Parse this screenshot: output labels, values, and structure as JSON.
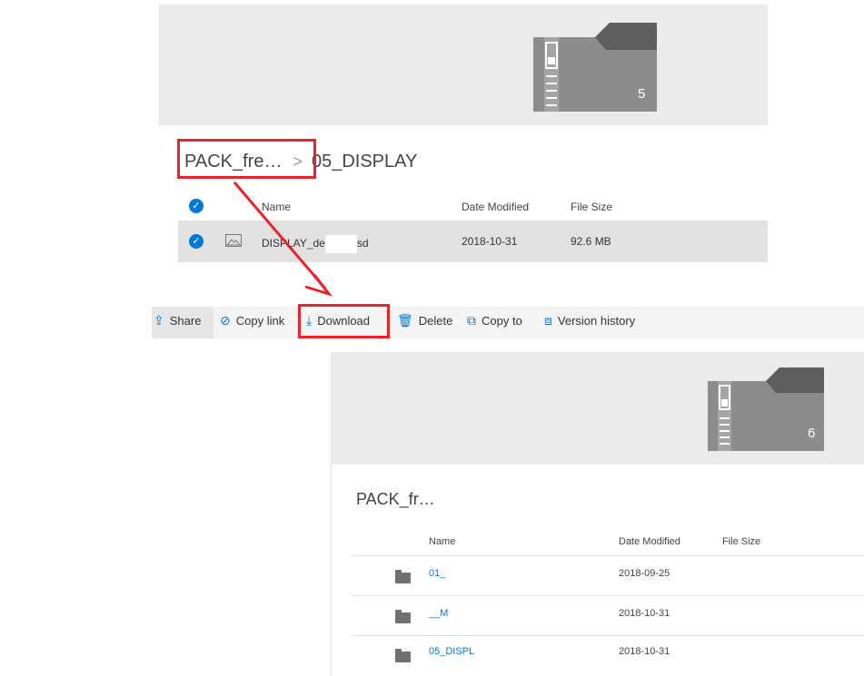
{
  "top_view": {
    "zip_count": "5",
    "breadcrumb": {
      "root": "PACK_fre…",
      "separator": ">",
      "current": "05_DISPLAY"
    },
    "columns": {
      "name": "Name",
      "date": "Date Modified",
      "size": "File Size"
    },
    "row": {
      "name": "DISPLAY_de",
      "name_suffix": "sd",
      "date": "2018-10-31",
      "size": "92.6 MB",
      "icon": "image-icon"
    }
  },
  "commands": {
    "share": "Share",
    "copy_link": "Copy link",
    "download": "Download",
    "delete": "Delete",
    "copy_to": "Copy to",
    "version_history": "Version history"
  },
  "bottom_view": {
    "zip_count": "6",
    "title": "PACK_fr…",
    "columns": {
      "name": "Name",
      "date": "Date Modified",
      "size": "File Size"
    },
    "rows": [
      {
        "name": "01_",
        "date": "2018-09-25"
      },
      {
        "name": "__M",
        "date": "2018-10-31"
      },
      {
        "name": "05_DISPL",
        "date": "2018-10-31"
      }
    ]
  },
  "colors": {
    "accent": "#0078d4",
    "highlight_red": "#e8232b",
    "hero_bg": "#ebebeb",
    "zip_gray": "#8c8c8c"
  }
}
